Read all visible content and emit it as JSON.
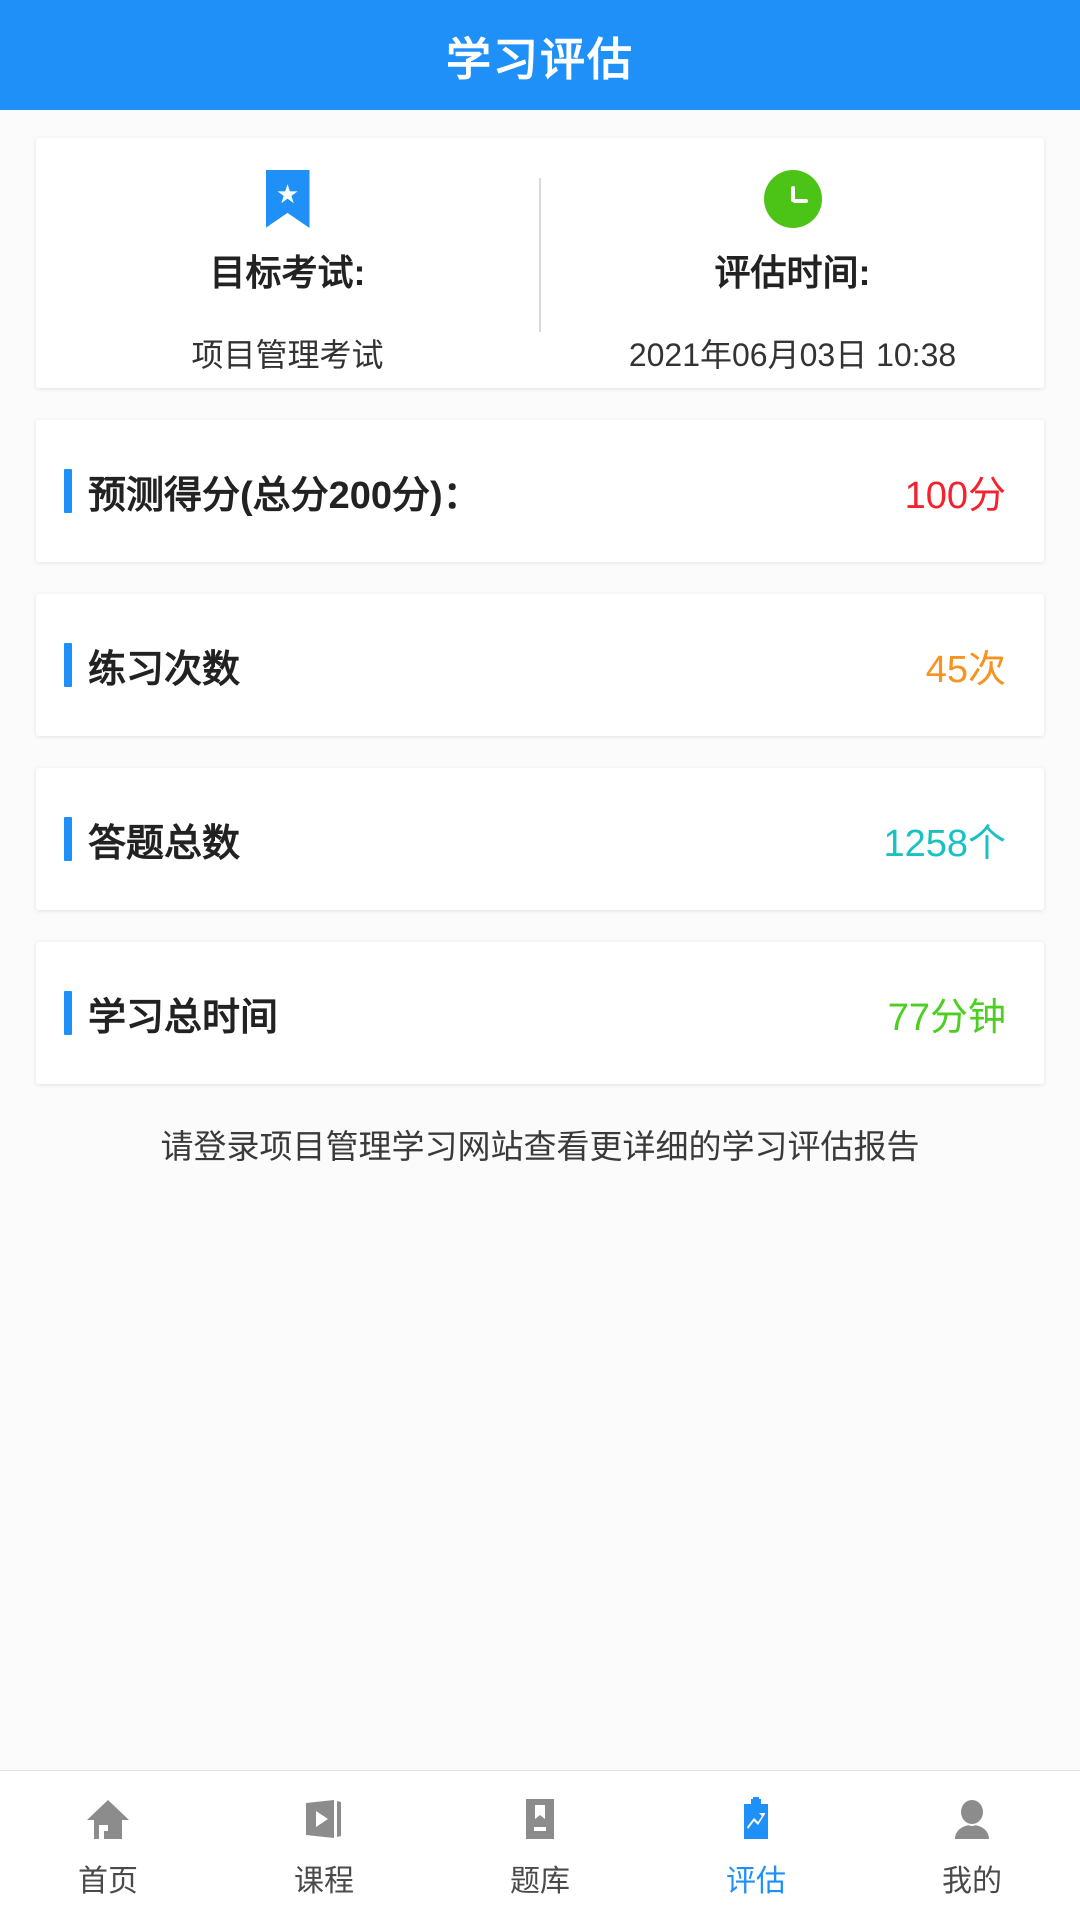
{
  "header": {
    "title": "学习评估"
  },
  "summary": {
    "exam": {
      "icon": "bookmark-star-icon",
      "label": "目标考试:",
      "value": "项目管理考试",
      "icon_color": "#1e90f8"
    },
    "time": {
      "icon": "clock-icon",
      "label": "评估时间:",
      "value": "2021年06月03日 10:38",
      "icon_color": "#4cc417"
    }
  },
  "stats": [
    {
      "label": "预测得分(总分200分)：",
      "value": "100分",
      "value_color": "#f5222d",
      "accent_color": "#1e90f8"
    },
    {
      "label": "练习次数",
      "value": "45次",
      "value_color": "#f79421",
      "accent_color": "#1e90f8"
    },
    {
      "label": "答题总数",
      "value": "1258个",
      "value_color": "#18c2c2",
      "accent_color": "#1e90f8"
    },
    {
      "label": "学习总时间",
      "value": "77分钟",
      "value_color": "#4ccf21",
      "accent_color": "#1e90f8"
    }
  ],
  "note": "请登录项目管理学习网站查看更详细的学习评估报告",
  "bottom_nav": {
    "active_color": "#1e90f8",
    "inactive_color": "#8c8c8c",
    "items": [
      {
        "icon": "home-icon",
        "label": "首页",
        "active": false
      },
      {
        "icon": "video-play-icon",
        "label": "课程",
        "active": false
      },
      {
        "icon": "book-icon",
        "label": "题库",
        "active": false
      },
      {
        "icon": "clipboard-chart-icon",
        "label": "评估",
        "active": true
      },
      {
        "icon": "person-icon",
        "label": "我的",
        "active": false
      }
    ]
  }
}
